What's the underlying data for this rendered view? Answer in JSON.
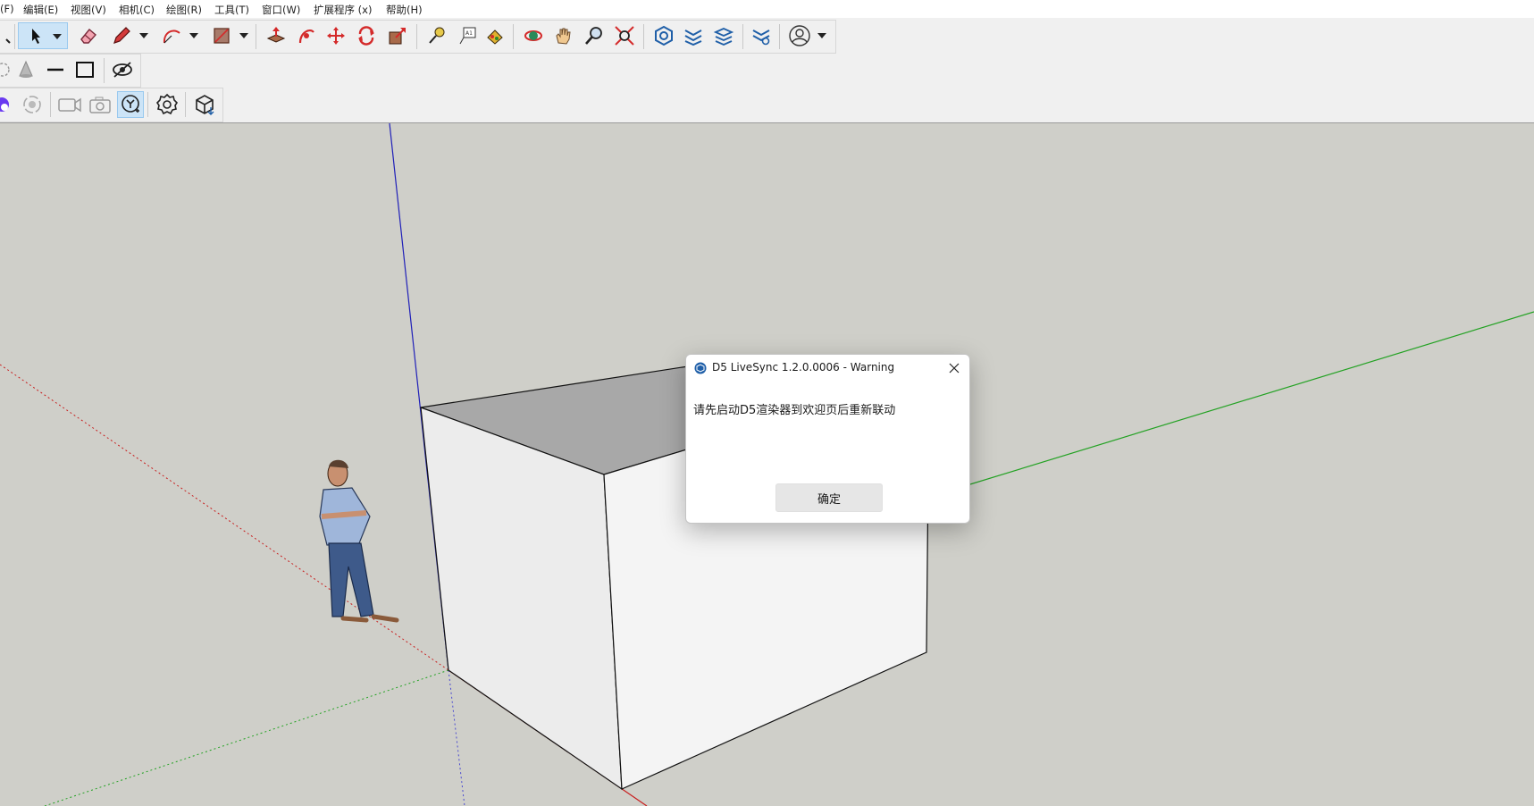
{
  "menubar": {
    "items": [
      "(F)",
      "编辑(E)",
      "视图(V)",
      "相机(C)",
      "绘图(R)",
      "工具(T)",
      "窗口(W)",
      "扩展程序 (x)",
      "帮助(H)"
    ]
  },
  "toolbar": {
    "row1_icons": [
      "select-arrow-icon",
      "eraser-icon",
      "pencil-line-icon",
      "arc-icon",
      "shape-icon",
      "push-pull-icon",
      "follow-me-icon",
      "move-icon",
      "rotate-icon",
      "scale-icon",
      "tape-measure-icon",
      "text-icon",
      "paint-bucket-icon",
      "orbit-icon",
      "pan-icon",
      "zoom-icon",
      "zoom-extents-icon",
      "3d-warehouse-icon",
      "extension-warehouse-icon",
      "layout-icon",
      "extension-manager-icon",
      "account-icon"
    ],
    "row2_icons": [
      "section-plane-icon",
      "cone-icon",
      "line-icon",
      "rectangle-icon",
      "hide-icon"
    ],
    "row3_icons": [
      "d5-logo-icon",
      "d5-sync-icon",
      "video-icon",
      "camera-icon",
      "d5-livesync-icon",
      "settings-icon",
      "export-box-icon"
    ],
    "active_tool": "select-arrow-icon",
    "active_d5_tool": "d5-livesync-icon"
  },
  "colors": {
    "viewport_bg": "#cfcfc9",
    "axis_blue": "#1f1fb8",
    "axis_red": "#c81e1e",
    "axis_green": "#23a223",
    "active_button_bg": "#cce4f7"
  },
  "dialog": {
    "title": "D5 LiveSync 1.2.0.0006 - Warning",
    "message": "请先启动D5渲染器到欢迎页后重新联动",
    "ok_label": "确定",
    "icon": "d5-app-icon",
    "close_icon": "close-icon"
  }
}
